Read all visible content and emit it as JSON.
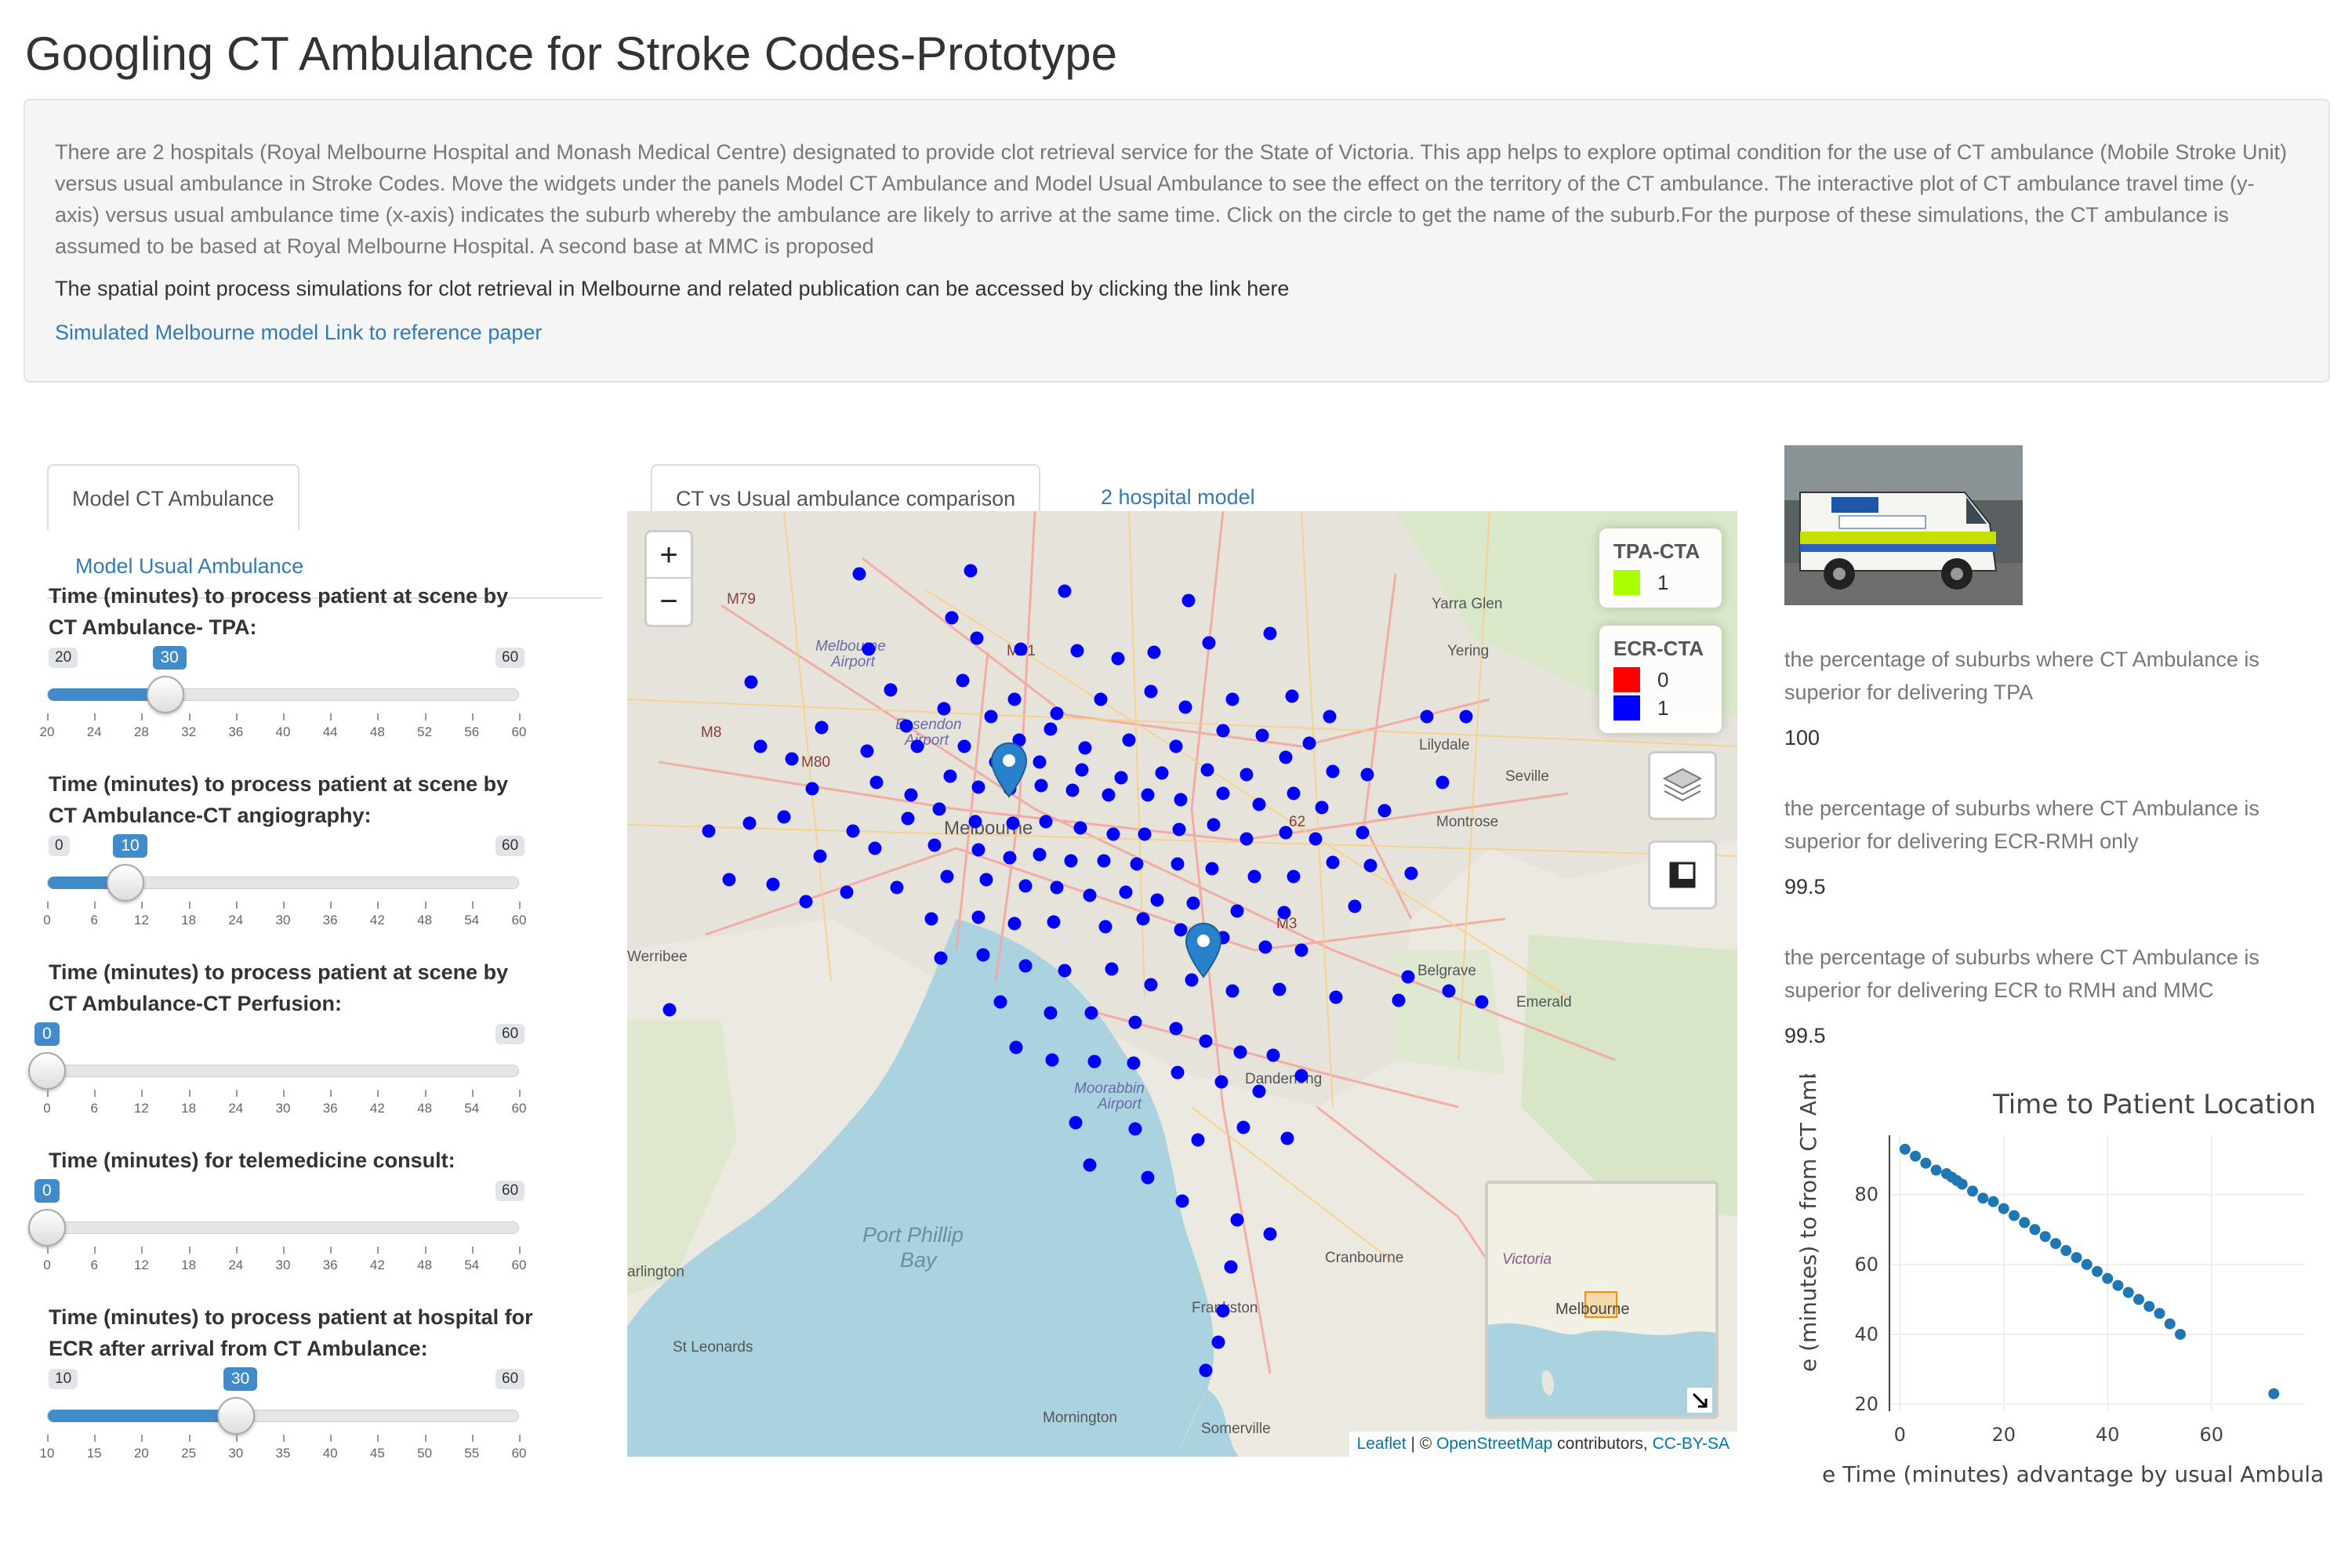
{
  "title": "Googling CT Ambulance for Stroke Codes-Prototype",
  "info": {
    "description": "There are 2 hospitals (Royal Melbourne Hospital and Monash Medical Centre) designated to provide clot retrieval service for the State of Victoria. This app helps to explore optimal condition for the use of CT ambulance (Mobile Stroke Unit) versus usual ambulance in Stroke Codes. Move the widgets under the panels Model CT Ambulance and Model Usual Ambulance to see the effect on the territory of the CT ambulance. The interactive plot of CT ambulance travel time (y-axis) versus usual ambulance time (x-axis) indicates the suburb whereby the ambulance are likely to arrive at the same time. Click on the circle to get the name of the suburb.For the purpose of these simulations, the CT ambulance is assumed to be based at Royal Melbourne Hospital. A second base at MMC is proposed",
    "spatial_line": "The spatial point process simulations for clot retrieval in Melbourne and related publication can be accessed by clicking the link here",
    "link_simulated": "Simulated Melbourne model",
    "link_reference": "Link to reference paper"
  },
  "left_tabs": {
    "active": "Model CT Ambulance",
    "other": "Model Usual Ambulance"
  },
  "sliders": [
    {
      "label": "Time (minutes) to process patient at scene by CT Ambulance- TPA:",
      "min": 20,
      "max": 60,
      "value": 30,
      "ticks": [
        20,
        24,
        28,
        32,
        36,
        40,
        44,
        48,
        52,
        56,
        60
      ]
    },
    {
      "label": "Time (minutes) to process patient at scene by CT Ambulance-CT angiography:",
      "min": 0,
      "max": 60,
      "value": 10,
      "ticks": [
        0,
        6,
        12,
        18,
        24,
        30,
        36,
        42,
        48,
        54,
        60
      ]
    },
    {
      "label": "Time (minutes) to process patient at scene by CT Ambulance-CT Perfusion:",
      "min": 0,
      "max": 60,
      "value": 0,
      "ticks": [
        0,
        6,
        12,
        18,
        24,
        30,
        36,
        42,
        48,
        54,
        60
      ]
    },
    {
      "label": "Time (minutes) for telemedicine consult:",
      "min": 0,
      "max": 60,
      "value": 0,
      "ticks": [
        0,
        6,
        12,
        18,
        24,
        30,
        36,
        42,
        48,
        54,
        60
      ]
    },
    {
      "label": "Time (minutes) to process patient at hospital for ECR after arrival from CT Ambulance:",
      "min": 10,
      "max": 60,
      "value": 30,
      "ticks": [
        10,
        15,
        20,
        25,
        30,
        35,
        40,
        45,
        50,
        55,
        60
      ]
    }
  ],
  "center_tabs": {
    "active": "CT vs Usual ambulance comparison",
    "other": "2 hospital model"
  },
  "map": {
    "zoom_in": "+",
    "zoom_out": "−",
    "legend_tpa": {
      "title": "TPA-CTA",
      "items": [
        {
          "color": "#aaff00",
          "label": "1"
        }
      ]
    },
    "legend_ecr": {
      "title": "ECR-CTA",
      "items": [
        {
          "color": "#ff0000",
          "label": "0"
        },
        {
          "color": "#0000ff",
          "label": "1"
        }
      ]
    },
    "place_labels": [
      "Yarra Glen",
      "Yering",
      "M79",
      "Melbourne Airport",
      "M31",
      "M8",
      "Essendon Airport",
      "M80",
      "Melbourne",
      "62",
      "Lilydale",
      "Seville",
      "Montrose",
      "M3",
      "Werribee",
      "Belgrave",
      "Emerald",
      "Port Phillip Bay",
      "Moorabbin Airport",
      "Dandenong",
      "Cranbourne",
      "Frankston",
      "arlington",
      "St Leonards",
      "Mornington",
      "Somerville"
    ],
    "minimap_labels": [
      "Victoria",
      "Melbourne"
    ],
    "layers_icon": "layers-icon",
    "fullscreen_icon": "fullscreen-icon",
    "attribution": {
      "leaflet": "Leaflet",
      "sep": " | © ",
      "osm": "OpenStreetMap",
      "contrib": " contributors, ",
      "license": "CC-BY-SA"
    }
  },
  "stats": [
    {
      "text": "the percentage of suburbs where CT Ambulance is superior for delivering TPA",
      "value": "100"
    },
    {
      "text": "the percentage of suburbs where CT Ambulance is superior for delivering ECR-RMH only",
      "value": "99.5"
    },
    {
      "text": "the percentage of suburbs where CT Ambulance is superior for delivering ECR to RMH and MMC",
      "value": "99.5"
    }
  ],
  "chart_data": {
    "type": "scatter",
    "title": "Time to Patient Location",
    "xlabel": "e Time (minutes) advantage by usual Ambula",
    "ylabel": "e (minutes) to from CT Ambulance",
    "xlim": [
      -2,
      78
    ],
    "ylim": [
      18,
      97
    ],
    "xticks": [
      0,
      20,
      40,
      60
    ],
    "yticks": [
      20,
      40,
      60,
      80
    ],
    "grid": true,
    "color": "#1f77b4",
    "series": [
      {
        "x": [
          1,
          3,
          5,
          7,
          9,
          10,
          11,
          12,
          14,
          16,
          18,
          20,
          22,
          24,
          26,
          28,
          30,
          32,
          34,
          36,
          38,
          40,
          42,
          44,
          46,
          48,
          50,
          52,
          54,
          72
        ],
        "y": [
          93,
          91,
          89,
          87,
          86,
          85,
          84,
          83,
          81,
          79,
          78,
          76,
          74,
          72,
          70,
          68,
          66,
          64,
          62,
          60,
          58,
          56,
          54,
          52,
          50,
          48,
          46,
          43,
          40,
          23
        ]
      }
    ]
  }
}
